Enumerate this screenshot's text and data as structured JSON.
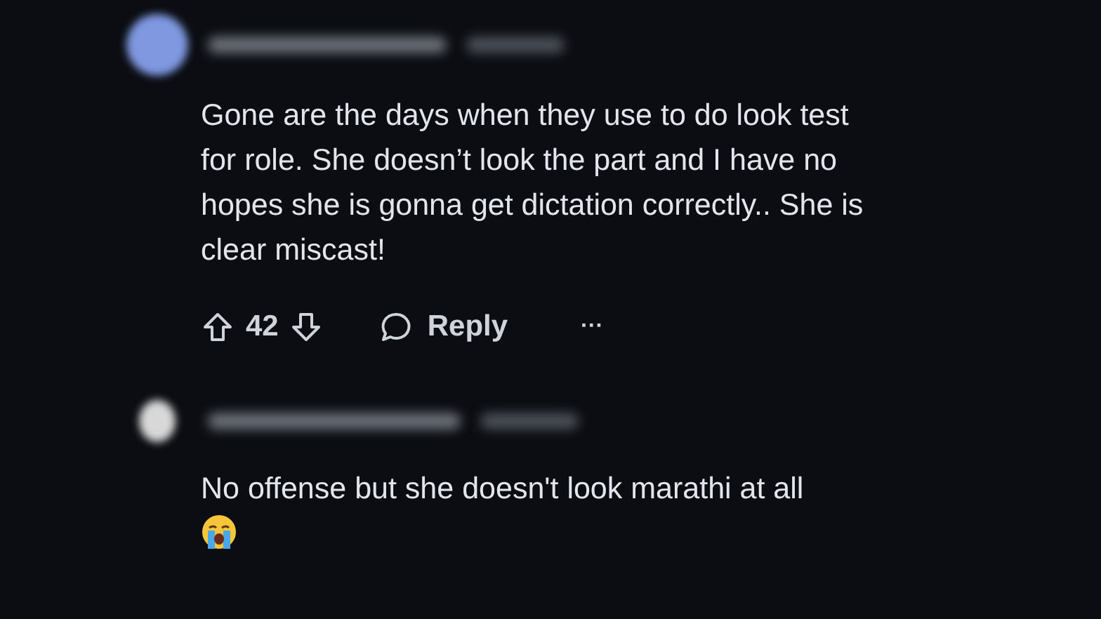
{
  "comments": [
    {
      "color": "#7f98e0",
      "text": "Gone are the days when they use to do look test for role. She doesn’t look the part and I have no hopes she is gonna get dictation correctly.. She is clear miscast!",
      "crying_emoji": false,
      "actions": {
        "votes": "42",
        "reply": "Reply",
        "more": "···"
      }
    },
    {
      "color": "#d8d8d8",
      "text": "No offense but she doesn't look marathi at all",
      "crying_emoji": true
    }
  ]
}
